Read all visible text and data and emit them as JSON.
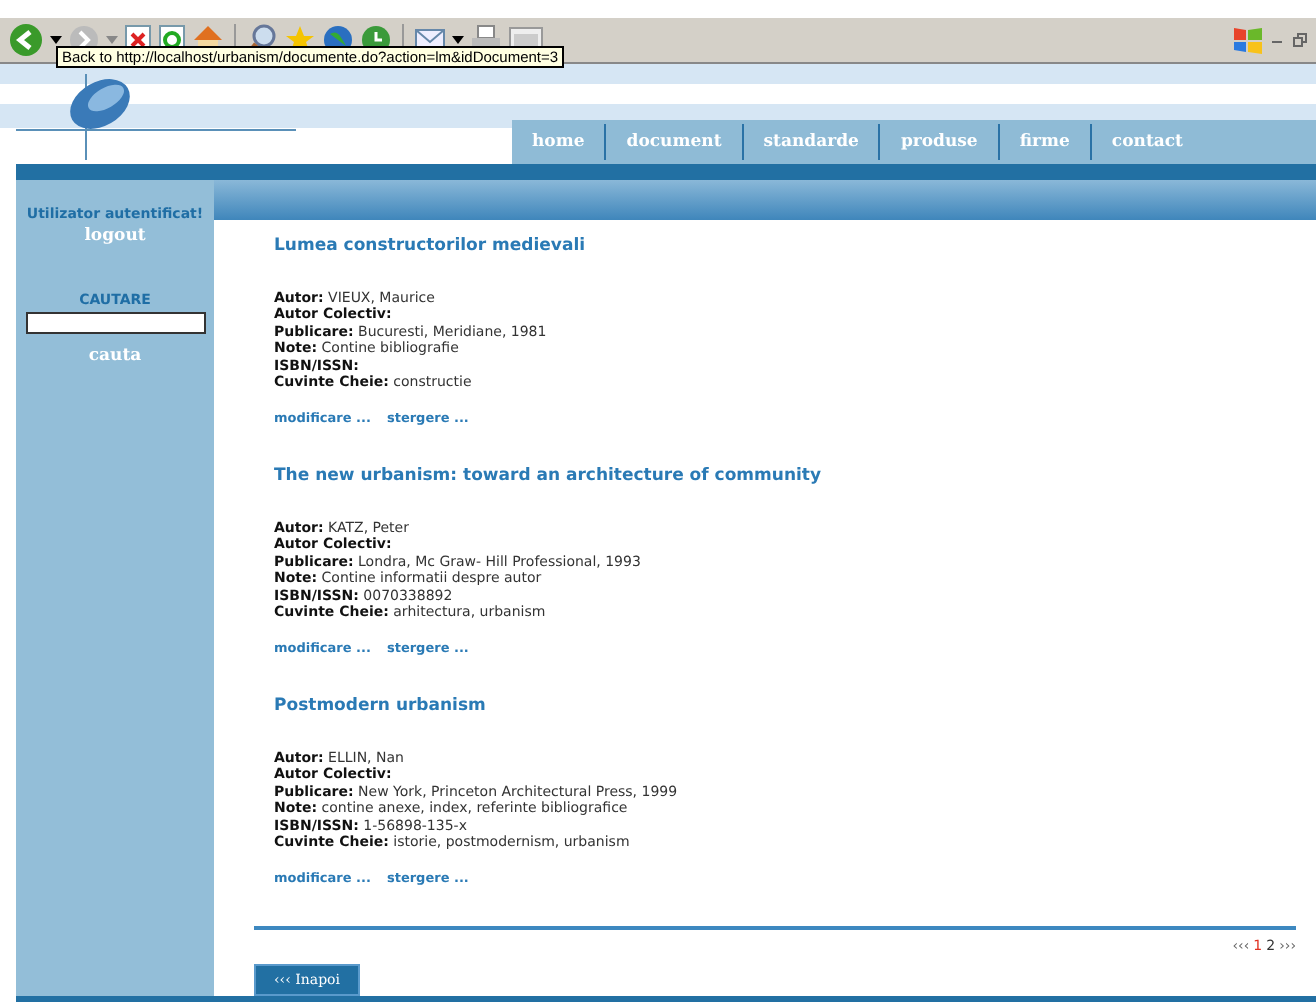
{
  "browser": {
    "tooltip": "Back to http://localhost/urbanism/documente.do?action=lm&idDocument=3"
  },
  "nav": [
    "home",
    "document",
    "standarde",
    "produse",
    "firme",
    "contact"
  ],
  "sidebar": {
    "status": "Utilizator autentificat!",
    "logout": "logout",
    "search_heading": "CAUTARE",
    "search_button": "cauta"
  },
  "entries": [
    {
      "title": "Lumea constructorilor medievali",
      "fields": [
        {
          "label": "Autor:",
          "value": "VIEUX, Maurice"
        },
        {
          "label": "Autor Colectiv:"
        },
        {
          "label": "Publicare:",
          "value": "Bucuresti, Meridiane, 1981"
        },
        {
          "label": "Note:",
          "value": "Contine bibliografie"
        },
        {
          "label": "ISBN/ISSN:"
        },
        {
          "label": "Cuvinte Cheie:",
          "value": "constructie"
        }
      ],
      "actions": [
        "modificare ...",
        "stergere ..."
      ]
    },
    {
      "title": "The new urbanism: toward an architecture of community",
      "fields": [
        {
          "label": "Autor:",
          "value": "KATZ, Peter"
        },
        {
          "label": "Autor Colectiv:"
        },
        {
          "label": "Publicare:",
          "value": "Londra, Mc Graw- Hill Professional, 1993"
        },
        {
          "label": "Note:",
          "value": "Contine informatii despre autor"
        },
        {
          "label": "ISBN/ISSN:",
          "value": "0070338892"
        },
        {
          "label": "Cuvinte Cheie:",
          "value": "arhitectura, urbanism"
        }
      ],
      "actions": [
        "modificare ...",
        "stergere ..."
      ]
    },
    {
      "title": "Postmodern urbanism",
      "fields": [
        {
          "label": "Autor:",
          "value": "ELLIN, Nan"
        },
        {
          "label": "Autor Colectiv:"
        },
        {
          "label": "Publicare:",
          "value": "New York, Princeton Architectural Press, 1999"
        },
        {
          "label": "Note:",
          "value": "contine anexe, index, referinte bibliografice"
        },
        {
          "label": "ISBN/ISSN:",
          "value": "1-56898-135-x"
        },
        {
          "label": "Cuvinte Cheie:",
          "value": "istorie, postmodernism, urbanism"
        }
      ],
      "actions": [
        "modificare ...",
        "stergere ..."
      ]
    }
  ],
  "pagination": {
    "prev": "‹‹‹",
    "pages": [
      {
        "label": "1",
        "selected": true
      },
      {
        "label": "2",
        "selected": false
      }
    ],
    "next": "›››"
  },
  "back_button": "‹‹‹ Inapoi"
}
